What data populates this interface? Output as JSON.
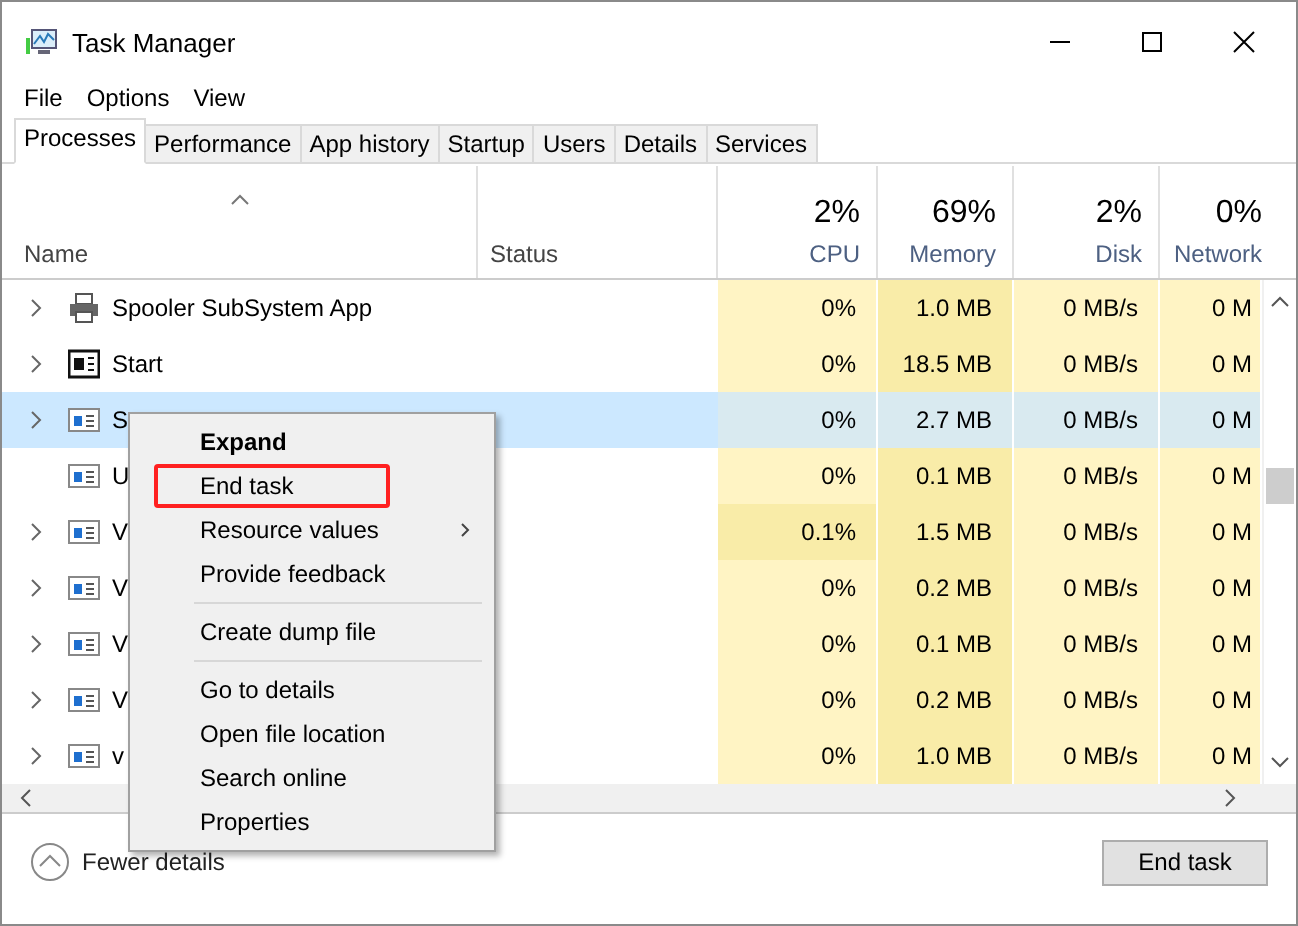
{
  "window": {
    "title": "Task Manager"
  },
  "menu": [
    "File",
    "Options",
    "View"
  ],
  "tabs": [
    {
      "label": "Processes",
      "selected": true
    },
    {
      "label": "Performance",
      "selected": false
    },
    {
      "label": "App history",
      "selected": false
    },
    {
      "label": "Startup",
      "selected": false
    },
    {
      "label": "Users",
      "selected": false
    },
    {
      "label": "Details",
      "selected": false
    },
    {
      "label": "Services",
      "selected": false
    }
  ],
  "columns": [
    {
      "label": "Name",
      "sorted": true
    },
    {
      "label": "Status",
      "sorted": false
    },
    {
      "percent": "2%",
      "label": "CPU",
      "sorted": false
    },
    {
      "percent": "69%",
      "label": "Memory",
      "sorted": false
    },
    {
      "percent": "2%",
      "label": "Disk",
      "sorted": false
    },
    {
      "percent": "0%",
      "label": "Network",
      "sorted": false
    }
  ],
  "rows": [
    {
      "name": "Spooler SubSystem App",
      "expandable": true,
      "kind": "printer",
      "selected": false,
      "cpu": "0%",
      "cpu_hot": false,
      "memory": "1.0 MB",
      "disk": "0 MB/s",
      "network": "0 M"
    },
    {
      "name": "Start",
      "expandable": true,
      "kind": "start",
      "selected": false,
      "cpu": "0%",
      "cpu_hot": false,
      "memory": "18.5 MB",
      "disk": "0 MB/s",
      "network": "0 M"
    },
    {
      "name": "S",
      "expandable": true,
      "kind": "app",
      "selected": true,
      "cpu": "0%",
      "cpu_hot": false,
      "memory": "2.7 MB",
      "disk": "0 MB/s",
      "network": "0 M"
    },
    {
      "name": "U",
      "expandable": false,
      "kind": "app",
      "selected": false,
      "cpu": "0%",
      "cpu_hot": false,
      "memory": "0.1 MB",
      "disk": "0 MB/s",
      "network": "0 M"
    },
    {
      "name": "V",
      "expandable": true,
      "kind": "app",
      "selected": false,
      "cpu": "0.1%",
      "cpu_hot": true,
      "memory": "1.5 MB",
      "disk": "0 MB/s",
      "network": "0 M"
    },
    {
      "name": "V",
      "expandable": true,
      "kind": "app",
      "selected": false,
      "cpu": "0%",
      "cpu_hot": false,
      "memory": "0.2 MB",
      "disk": "0 MB/s",
      "network": "0 M"
    },
    {
      "name": "V",
      "expandable": true,
      "kind": "app",
      "selected": false,
      "cpu": "0%",
      "cpu_hot": false,
      "memory": "0.1 MB",
      "disk": "0 MB/s",
      "network": "0 M"
    },
    {
      "name": "V",
      "expandable": true,
      "kind": "app",
      "selected": false,
      "cpu": "0%",
      "cpu_hot": false,
      "memory": "0.2 MB",
      "disk": "0 MB/s",
      "network": "0 M"
    },
    {
      "name": "v",
      "expandable": true,
      "kind": "app",
      "selected": false,
      "cpu": "0%",
      "cpu_hot": false,
      "memory": "1.0 MB",
      "disk": "0 MB/s",
      "network": "0 M"
    }
  ],
  "context_menu": [
    {
      "kind": "item",
      "label": "Expand",
      "bold": true,
      "submenu": false,
      "marked": false
    },
    {
      "kind": "item",
      "label": "End task",
      "bold": false,
      "submenu": false,
      "marked": true
    },
    {
      "kind": "item",
      "label": "Resource values",
      "bold": false,
      "submenu": true,
      "marked": false
    },
    {
      "kind": "item",
      "label": "Provide feedback",
      "bold": false,
      "submenu": false,
      "marked": false
    },
    {
      "kind": "separator"
    },
    {
      "kind": "item",
      "label": "Create dump file",
      "bold": false,
      "submenu": false,
      "marked": false
    },
    {
      "kind": "separator"
    },
    {
      "kind": "item",
      "label": "Go to details",
      "bold": false,
      "submenu": false,
      "marked": false
    },
    {
      "kind": "item",
      "label": "Open file location",
      "bold": false,
      "submenu": false,
      "marked": false
    },
    {
      "kind": "item",
      "label": "Search online",
      "bold": false,
      "submenu": false,
      "marked": false
    },
    {
      "kind": "item",
      "label": "Properties",
      "bold": false,
      "submenu": false,
      "marked": false
    }
  ],
  "footer": {
    "toggle": "Fewer details",
    "button": "End task"
  }
}
